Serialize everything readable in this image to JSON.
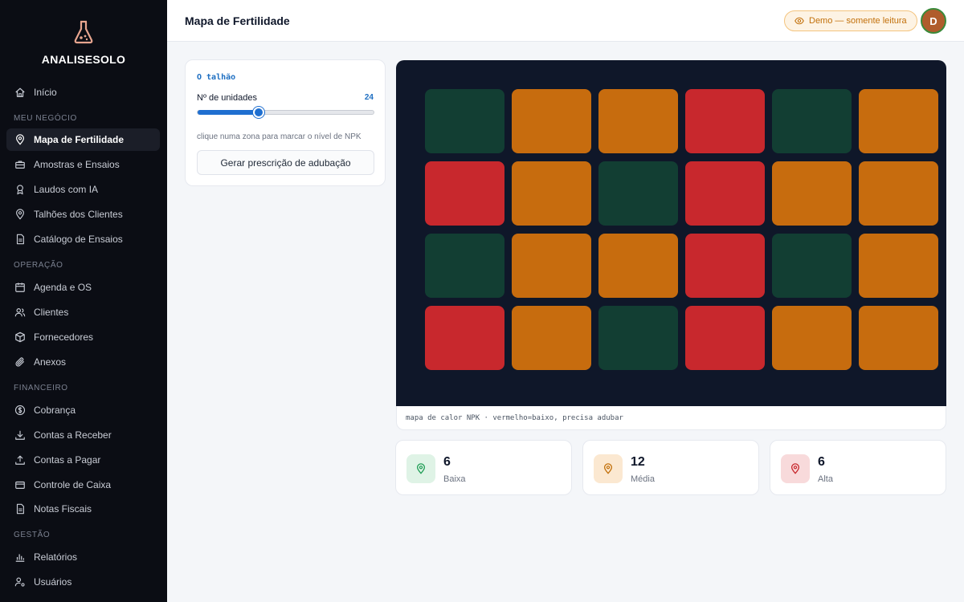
{
  "brand": {
    "name": "ANALISESOLO"
  },
  "nav": {
    "home": "Início",
    "sections": {
      "business": "MEU NEGÓCIO",
      "operation": "OPERAÇÃO",
      "financial": "FINANCEIRO",
      "management": "GESTÃO"
    },
    "items": {
      "fertility_map": "Mapa de Fertilidade",
      "samples": "Amostras e Ensaios",
      "reports_ai": "Laudos com IA",
      "client_plots": "Talhões dos Clientes",
      "catalog": "Catálogo de Ensaios",
      "schedule": "Agenda e OS",
      "clients": "Clientes",
      "suppliers": "Fornecedores",
      "attachments": "Anexos",
      "billing": "Cobrança",
      "receivables": "Contas a Receber",
      "payables": "Contas a Pagar",
      "cash": "Controle de Caixa",
      "invoices": "Notas Fiscais",
      "reports": "Relatórios",
      "users": "Usuários"
    },
    "active": "fertility_map"
  },
  "header": {
    "title": "Mapa de Fertilidade",
    "demo_badge": "Demo — somente leitura",
    "avatar_initial": "D"
  },
  "control": {
    "title": "O talhão",
    "units_label": "Nº de unidades",
    "units_value": "24",
    "slider": {
      "min": 4,
      "max": 64,
      "value": 24
    },
    "hint": "clique numa zona para marcar o nível de NPK",
    "generate_button": "Gerar prescrição de adubação"
  },
  "heatmap": {
    "columns": 6,
    "rows": 4,
    "colors": {
      "baixa": "#c8282d",
      "media": "#c76c0e",
      "alta": "#123e33"
    },
    "cells": [
      "alta",
      "media",
      "media",
      "baixa",
      "alta",
      "media",
      "baixa",
      "media",
      "alta",
      "baixa",
      "media",
      "media",
      "alta",
      "media",
      "media",
      "baixa",
      "alta",
      "media",
      "baixa",
      "media",
      "alta",
      "baixa",
      "media",
      "media"
    ],
    "caption": "mapa de calor NPK · vermelho=baixo, precisa adubar"
  },
  "stats": {
    "low": {
      "value": "6",
      "label": "Baixa",
      "color": "#1f9d55",
      "bg": "#dff3e6"
    },
    "medium": {
      "value": "12",
      "label": "Média",
      "color": "#c2700a",
      "bg": "#fbe8d1"
    },
    "high": {
      "value": "6",
      "label": "Alta",
      "color": "#c8282d",
      "bg": "#f8dadb"
    }
  }
}
